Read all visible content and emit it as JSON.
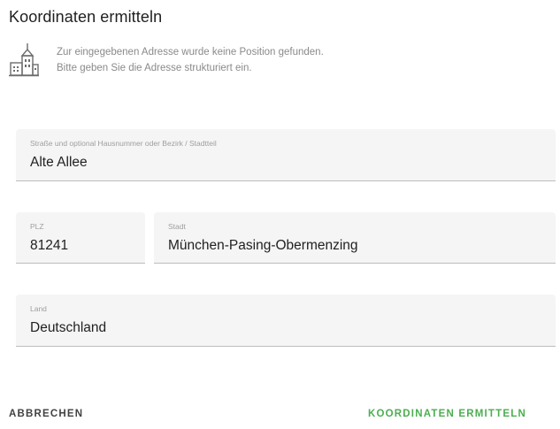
{
  "dialog": {
    "title": "Koordinaten ermitteln",
    "info": {
      "icon": "city-buildings-icon",
      "line1": "Zur eingegebenen Adresse wurde keine Position gefunden.",
      "line2": "Bitte geben Sie die Adresse strukturiert ein."
    },
    "fields": {
      "street": {
        "label": "Straße und optional Hausnummer oder Bezirk / Stadtteil",
        "value": "Alte Allee"
      },
      "plz": {
        "label": "PLZ",
        "value": "81241"
      },
      "city": {
        "label": "Stadt",
        "value": "München-Pasing-Obermenzing"
      },
      "country": {
        "label": "Land",
        "value": "Deutschland"
      }
    },
    "actions": {
      "cancel_label": "ABBRECHEN",
      "confirm_label": "KOORDINATEN ERMITTELN"
    },
    "colors": {
      "accent": "#4caf50",
      "field_bg": "#f5f5f5"
    }
  }
}
